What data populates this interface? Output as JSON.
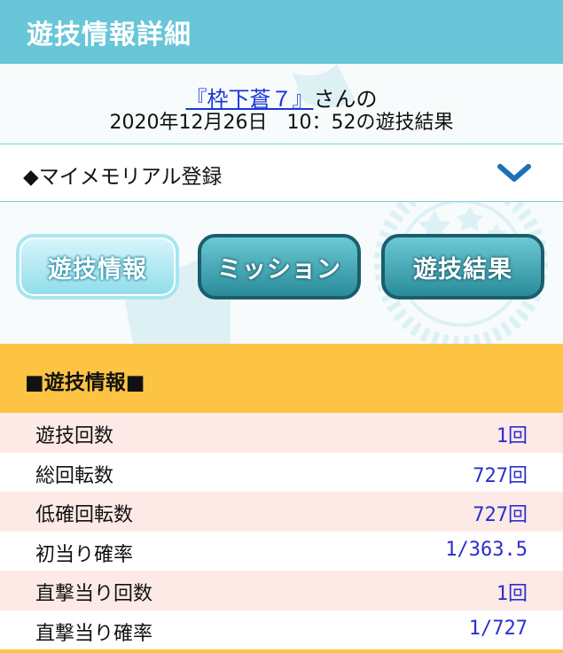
{
  "header": {
    "title": "遊技情報詳細"
  },
  "result": {
    "user_name": "『枠下蒼７』",
    "user_suffix": "さんの",
    "date_line": "2020年12月26日　10：52の遊技結果"
  },
  "memorial": {
    "label": "◆マイメモリアル登録",
    "icon": "chevron-down-icon"
  },
  "tabs": [
    {
      "label": "遊技情報",
      "active": true
    },
    {
      "label": "ミッション",
      "active": false
    },
    {
      "label": "遊技結果",
      "active": false
    }
  ],
  "section": {
    "title": "■遊技情報■"
  },
  "stats": [
    {
      "label": "遊技回数",
      "value": "1回"
    },
    {
      "label": "総回転数",
      "value": "727回"
    },
    {
      "label": "低確回転数",
      "value": "727回"
    },
    {
      "label": "初当り確率",
      "value": "1/363.5"
    },
    {
      "label": "直撃当り回数",
      "value": "1回"
    },
    {
      "label": "直撃当り確率",
      "value": "1/727"
    }
  ],
  "colors": {
    "header": "#68c6d8",
    "section": "#fdc444",
    "row_alt": "#fde9e6",
    "link": "#1a35d8",
    "value": "#2a2fd0"
  }
}
